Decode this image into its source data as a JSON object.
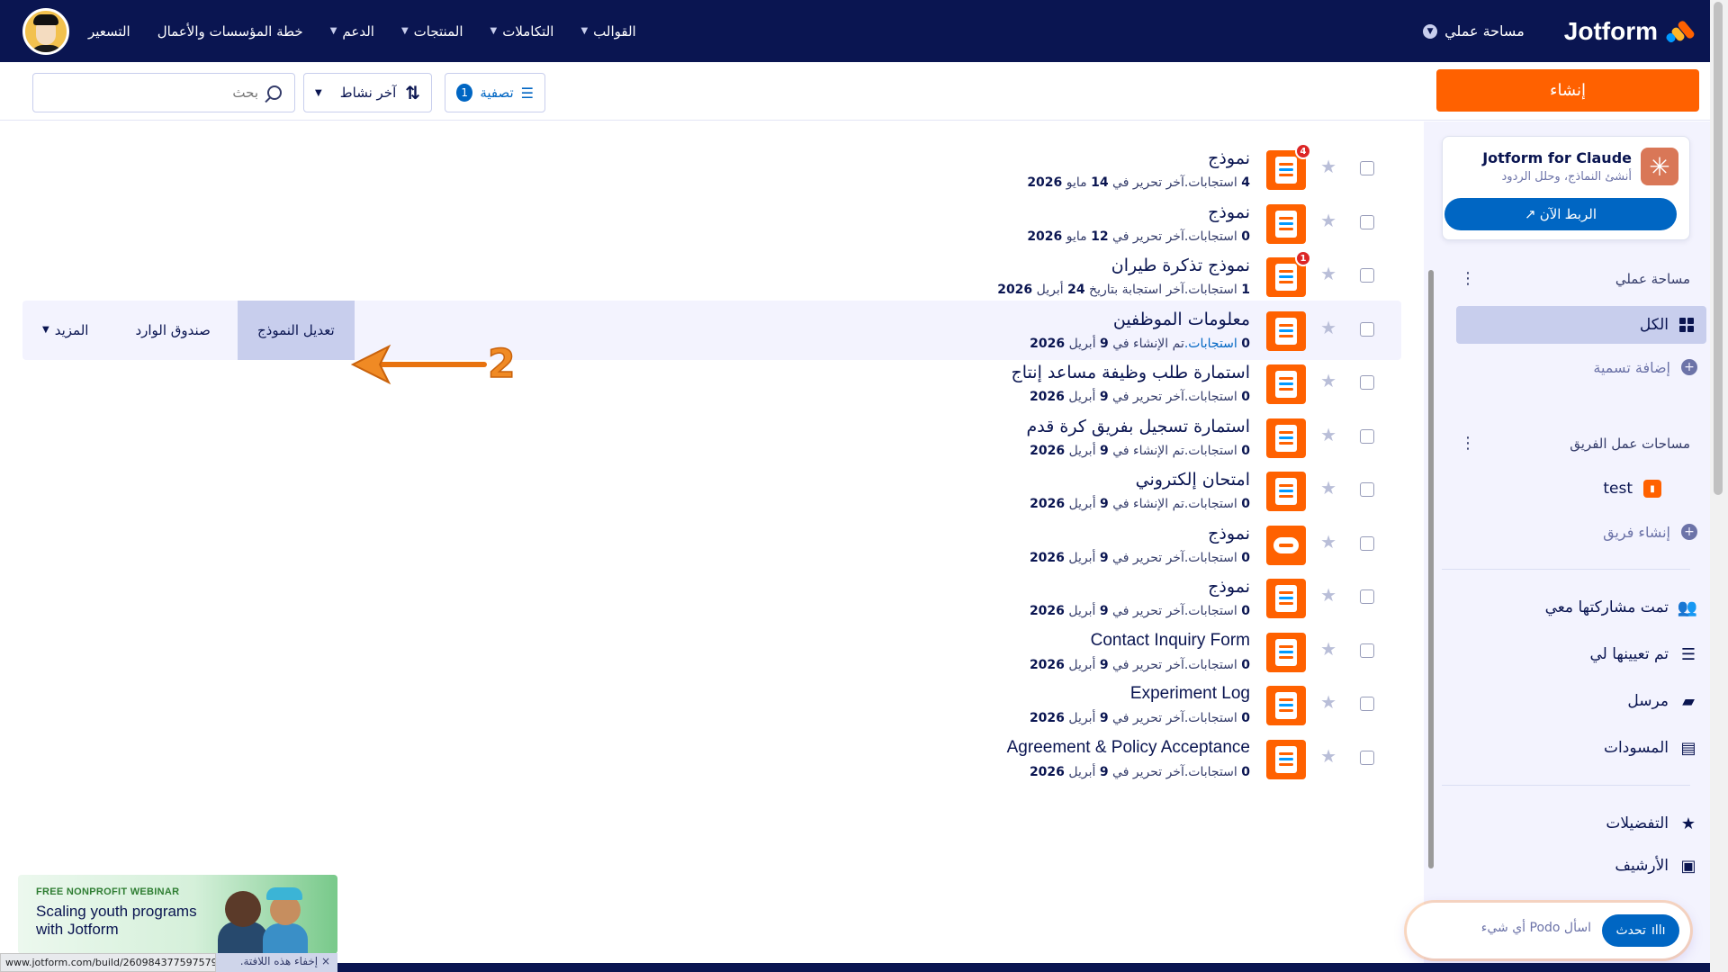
{
  "nav": {
    "brand": "Jotform",
    "workspace": "مساحة عملي",
    "links": [
      {
        "label": "القوالب",
        "caret": true
      },
      {
        "label": "التكاملات",
        "caret": true
      },
      {
        "label": "المنتجات",
        "caret": true
      },
      {
        "label": "الدعم",
        "caret": true
      },
      {
        "label": "خطة المؤسسات والأعمال",
        "caret": false
      },
      {
        "label": "التسعير",
        "caret": false
      }
    ]
  },
  "toolbar": {
    "create_label": "إنشاء",
    "filter_label": "تصفية",
    "filter_count": "1",
    "sort_label": "آخر نشاط",
    "search_placeholder": "بحث"
  },
  "sidebar": {
    "claude": {
      "title": "Jotform for Claude",
      "subtitle": "أنشئ النماذج، وحلل الردود",
      "button": "الربط الآن ↗"
    },
    "workspace_heading": "مساحة عملي",
    "all_label": "الكل",
    "add_label": "إضافة تسمية",
    "team_heading": "مساحات عمل الفريق",
    "team_name": "test",
    "create_team": "إنشاء فريق",
    "shared": "تمت مشاركتها معي",
    "assigned": "تم تعيينها لي",
    "sent": "مرسل",
    "drafts": "المسودات",
    "favorites": "التفضيلات",
    "archive": "الأرشيف"
  },
  "podo": {
    "button": "تحدث",
    "placeholder": "اسأل Podo أي شيء"
  },
  "rows": [
    {
      "title": "نموذج",
      "count": "4",
      "resp": "استجابات.",
      "action": "آخر تحرير في",
      "day": "14",
      "month": "مايو",
      "year": "2026",
      "badge": "4"
    },
    {
      "title": "نموذج",
      "count": "0",
      "resp": "استجابات.",
      "action": "آخر تحرير في",
      "day": "12",
      "month": "مايو",
      "year": "2026",
      "badge": ""
    },
    {
      "title": "نموذج تذكرة طيران",
      "count": "1",
      "resp": "استجابات.",
      "action": "آخر استجابة بتاريخ",
      "day": "24",
      "month": "أبريل",
      "year": "2026",
      "badge": "1"
    },
    {
      "title": "معلومات الموظفين",
      "count": "0",
      "resp": "استجابات.",
      "action": "تم الإنشاء في",
      "day": "9",
      "month": "أبريل",
      "year": "2026",
      "badge": ""
    },
    {
      "title": "استمارة طلب وظيفة مساعد إنتاج",
      "count": "0",
      "resp": "استجابات.",
      "action": "آخر تحرير في",
      "day": "9",
      "month": "أبريل",
      "year": "2026",
      "badge": ""
    },
    {
      "title": "استمارة تسجيل بفريق كرة قدم",
      "count": "0",
      "resp": "استجابات.",
      "action": "تم الإنشاء في",
      "day": "9",
      "month": "أبريل",
      "year": "2026",
      "badge": ""
    },
    {
      "title": "امتحان إلكتروني",
      "count": "0",
      "resp": "استجابات.",
      "action": "تم الإنشاء في",
      "day": "9",
      "month": "أبريل",
      "year": "2026",
      "badge": ""
    },
    {
      "title": "نموذج",
      "count": "0",
      "resp": "استجابات.",
      "action": "آخر تحرير في",
      "day": "9",
      "month": "أبريل",
      "year": "2026",
      "badge": ""
    },
    {
      "title": "نموذج",
      "count": "0",
      "resp": "استجابات.",
      "action": "آخر تحرير في",
      "day": "9",
      "month": "أبريل",
      "year": "2026",
      "badge": ""
    },
    {
      "title": "Contact Inquiry Form",
      "count": "0",
      "resp": "استجابات.",
      "action": "آخر تحرير في",
      "day": "9",
      "month": "أبريل",
      "year": "2026",
      "badge": ""
    },
    {
      "title": "Experiment Log",
      "count": "0",
      "resp": "استجابات.",
      "action": "آخر تحرير في",
      "day": "9",
      "month": "أبريل",
      "year": "2026",
      "badge": ""
    },
    {
      "title": "Agreement & Policy Acceptance",
      "count": "0",
      "resp": "استجابات.",
      "action": "آخر تحرير في",
      "day": "9",
      "month": "أبريل",
      "year": "2026",
      "badge": ""
    }
  ],
  "row_actions": {
    "edit": "تعديل النموذج",
    "inbox": "صندوق الوارد",
    "more": "المزيد"
  },
  "annotation": {
    "number": "2"
  },
  "promo": {
    "tag": "FREE NONPROFIT WEBINAR",
    "headline": "Scaling youth programs with Jotform"
  },
  "status": {
    "url": "www.jotform.com/build/260984377597579",
    "hide_tab": "إخفاء هذه اللافتة.",
    "close": "×"
  },
  "colors": {
    "navy": "#0a1551",
    "orange": "#ff6100",
    "blue": "#0066c3"
  }
}
